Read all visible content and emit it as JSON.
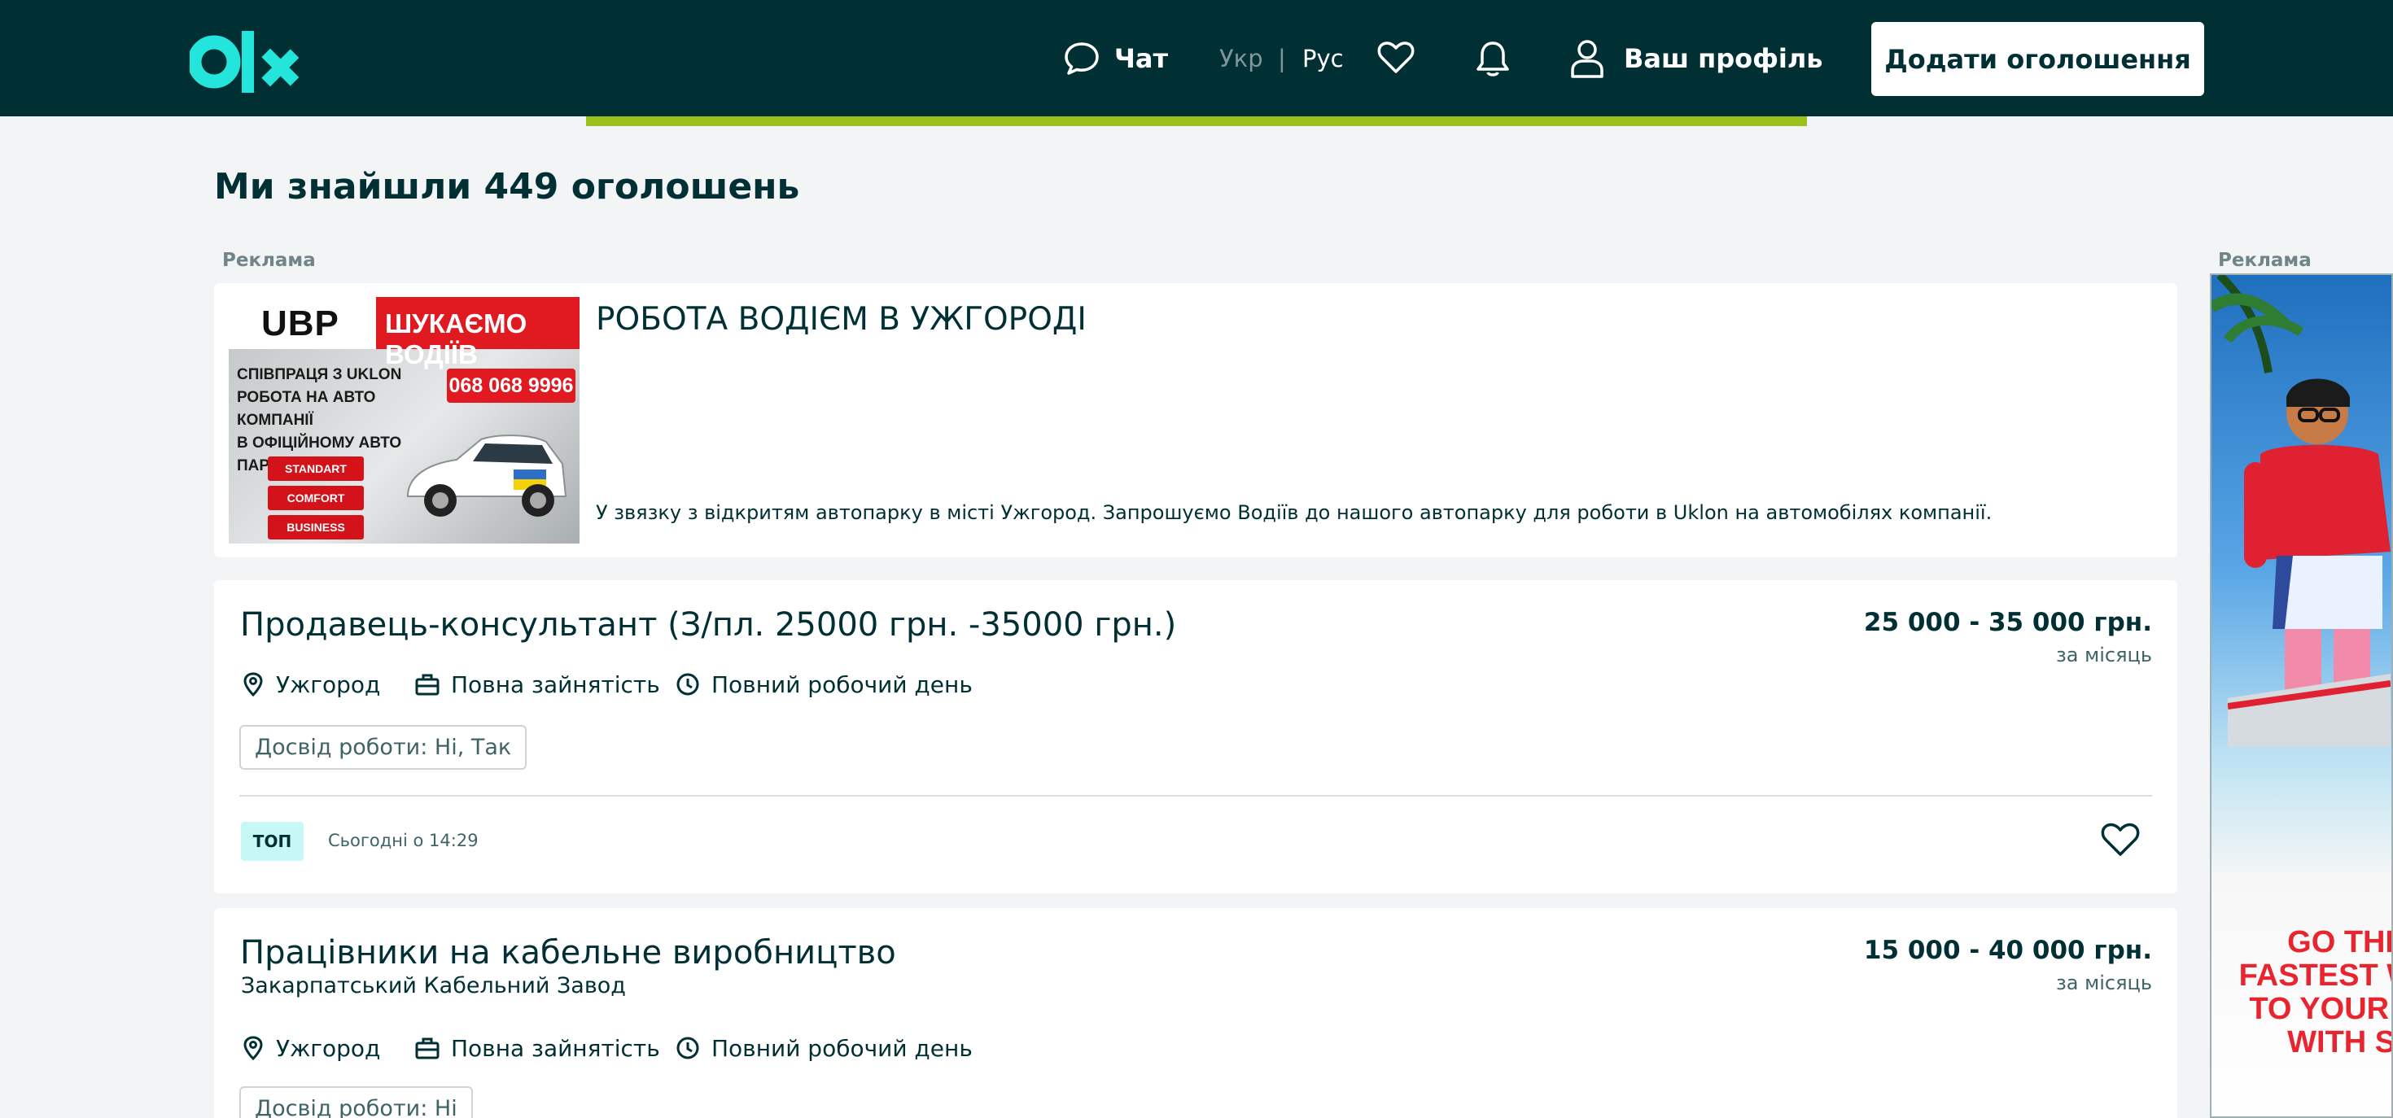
{
  "header": {
    "logo": "olx",
    "chat_label": "Чат",
    "lang_ukr": "Укр",
    "lang_separator": "|",
    "lang_rus": "Рус",
    "profile_label": "Ваш профіль",
    "add_button_label": "Додати оголошення"
  },
  "results": {
    "title": "Ми знайшли 449 оголошень"
  },
  "ad_label": "Реклама",
  "promo": {
    "title": "РОБОТА ВОДІЄМ В УЖГОРОДІ",
    "description": "У звязку з відкритям автопарку в місті Ужгород. Запрошуємо Водіїв до нашого автопарку для роботи в Uklon на автомобілях компанії.",
    "image": {
      "brand": "UBP",
      "slogan": "ШУКАЄМО ВОДІЇВ",
      "line_1": "СПІВПРАЦЯ З UKLON",
      "line_2": "РОБОТА НА АВТО КОМПАНІЇ",
      "line_3": "В ОФІЦІЙНОМУ АВТО ПАРКУ",
      "phone": "068 068 9996",
      "tariffs": [
        "STANDART",
        "COMFORT",
        "BUSINESS"
      ]
    }
  },
  "listings": [
    {
      "title": "Продавець-консультант (З/пл. 25000 грн. -35000 грн.)",
      "company": "",
      "price": "25 000 - 35 000 грн.",
      "period": "за місяць",
      "location": "Ужгород",
      "employment": "Повна зайнятість",
      "schedule": "Повний робочий день",
      "experience": "Досвід роботи: Ні, Так",
      "badge": "ТОП",
      "date": "Сьогодні о 14:29"
    },
    {
      "title": "Працівники на кабельне виробництво",
      "company": "Закарпатський Кабельний Завод",
      "price": "15 000 - 40 000 грн.",
      "period": "за місяць",
      "location": "Ужгород",
      "employment": "Повна зайнятість",
      "schedule": "Повний робочий день",
      "experience": "Досвід роботи: Ні"
    }
  ],
  "side_ad": {
    "slogan": "GO THE FASTEST WAY TO YOUR HO WITH St"
  },
  "colors": {
    "header_bg": "#002f34",
    "page_bg": "#f2f4f5",
    "accent_teal": "#23e5db",
    "progress_green": "#9ac21a",
    "top_badge_bg": "#c8f8f6"
  },
  "icons": [
    "olx-logo",
    "chat-icon",
    "heart-icon",
    "bell-icon",
    "user-icon",
    "location-icon",
    "briefcase-icon",
    "clock-icon"
  ]
}
